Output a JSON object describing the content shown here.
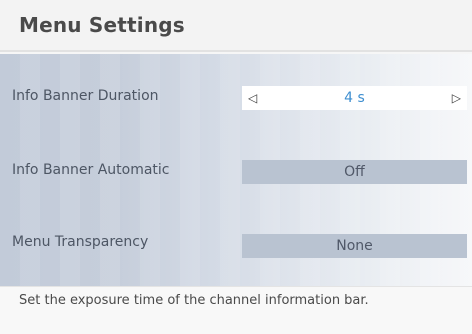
{
  "header": {
    "title": "Menu Settings"
  },
  "settings": [
    {
      "label": "Info Banner Duration",
      "value": "4 s"
    },
    {
      "label": "Info Banner Automatic",
      "value": "Off"
    },
    {
      "label": "Menu Transparency",
      "value": "None"
    }
  ],
  "arrows": {
    "left": "◁",
    "right": "▷"
  },
  "footer": {
    "help_text": "Set the exposure time of the channel information bar."
  },
  "colors": {
    "selected_value": "#3f8fd0",
    "panel": "#c6cedb",
    "value_box": "#b9c3d1"
  }
}
